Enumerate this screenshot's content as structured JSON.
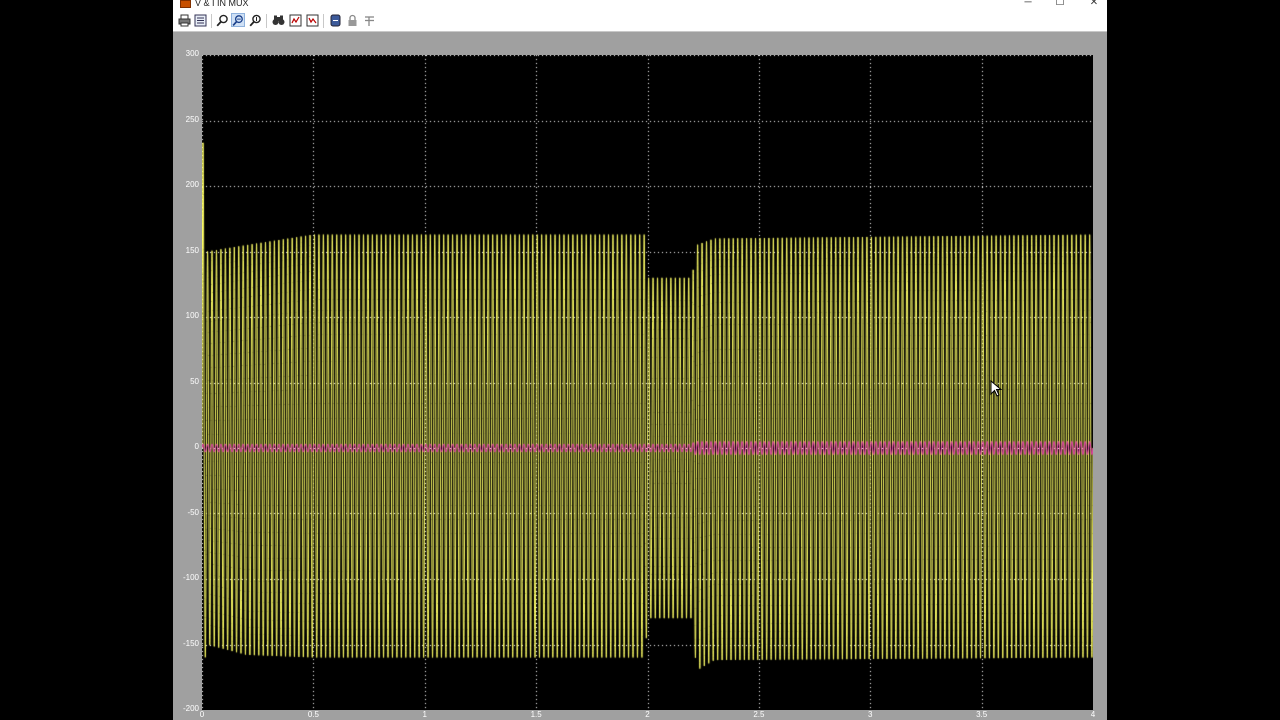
{
  "window": {
    "title": "V & I IN MUX",
    "controls": {
      "minimize": "─",
      "maximize": "☐",
      "close": "✕"
    }
  },
  "toolbar": {
    "buttons": [
      {
        "name": "print-icon",
        "active": false
      },
      {
        "name": "parameters-icon",
        "active": false
      },
      {
        "name": "zoom-icon",
        "active": false
      },
      {
        "name": "zoom-x-icon",
        "active": true
      },
      {
        "name": "zoom-y-icon",
        "active": false
      },
      {
        "name": "autoscale-icon",
        "active": false
      },
      {
        "name": "save-axes-icon",
        "active": false
      },
      {
        "name": "restore-axes-icon",
        "active": false
      },
      {
        "name": "floating-scope-icon",
        "active": false
      },
      {
        "name": "lock-axes-icon",
        "active": false
      },
      {
        "name": "signal-selection-icon",
        "active": false
      }
    ]
  },
  "colors": {
    "window_frame": "#a0a0a0",
    "plot_background": "#000000",
    "voltage_trace": "#ffff66",
    "current_trace": "#ff33cc",
    "grid": "#ffffff"
  },
  "chart_data": {
    "type": "line",
    "title": "",
    "xlabel": "",
    "ylabel": "",
    "xlim": [
      0,
      4
    ],
    "ylim": [
      -200,
      300
    ],
    "x_ticks": [
      "0",
      "0.5",
      "1",
      "1.5",
      "2",
      "2.5",
      "3",
      "3.5",
      "4"
    ],
    "y_ticks": [
      "300",
      "250",
      "200",
      "150",
      "100",
      "50",
      "0",
      "-50",
      "-100",
      "-150",
      "-200"
    ],
    "grid": true,
    "series": [
      {
        "color": "#ffff66",
        "kind": "sinusoid-envelope",
        "cycles_per_unit": 50,
        "envelope": [
          {
            "x": 0.0,
            "pos": 260,
            "neg": -190
          },
          {
            "x": 0.02,
            "pos": 150,
            "neg": -150
          },
          {
            "x": 0.2,
            "pos": 155,
            "neg": -158
          },
          {
            "x": 0.5,
            "pos": 163,
            "neg": -160
          },
          {
            "x": 1.99,
            "pos": 163,
            "neg": -160
          },
          {
            "x": 2.0,
            "pos": 130,
            "neg": -130
          },
          {
            "x": 2.2,
            "pos": 130,
            "neg": -130
          },
          {
            "x": 2.22,
            "pos": 155,
            "neg": -170
          },
          {
            "x": 2.3,
            "pos": 160,
            "neg": -162
          },
          {
            "x": 4.0,
            "pos": 163,
            "neg": -160
          }
        ]
      },
      {
        "color": "#ff33cc",
        "kind": "sinusoid-envelope",
        "cycles_per_unit": 50,
        "envelope": [
          {
            "x": 0.0,
            "pos": 3,
            "neg": -3
          },
          {
            "x": 2.2,
            "pos": 3,
            "neg": -3
          },
          {
            "x": 2.21,
            "pos": 5,
            "neg": -5
          },
          {
            "x": 4.0,
            "pos": 5,
            "neg": -5
          }
        ]
      }
    ]
  }
}
